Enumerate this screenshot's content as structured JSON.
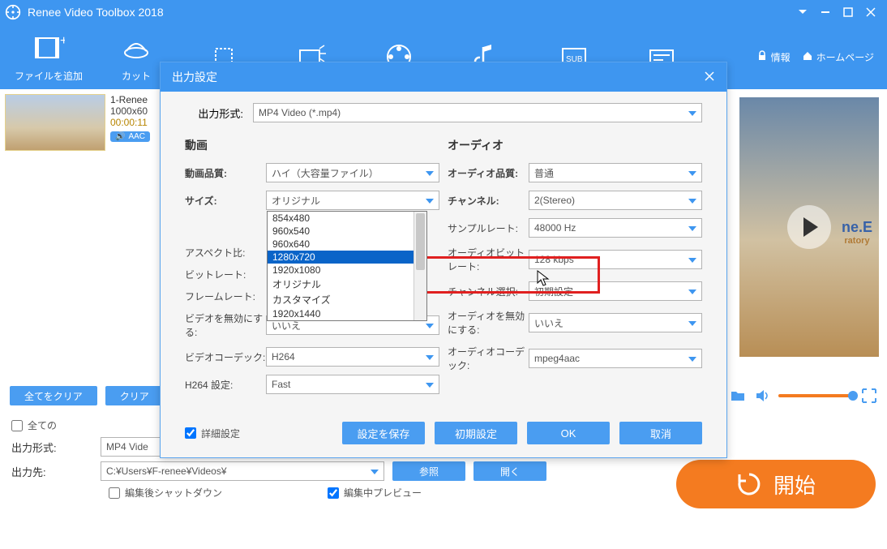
{
  "app": {
    "title": "Renee Video Toolbox 2018"
  },
  "window_buttons": {
    "drop": "▾",
    "min": "—",
    "max": "□",
    "close": "✕"
  },
  "toolbar": {
    "add_file": "ファイルを追加",
    "cut": "カット"
  },
  "header_links": {
    "info": "情報",
    "home": "ホームページ"
  },
  "file": {
    "name": "1-Renee",
    "size": "1000x60",
    "duration": "00:00:11",
    "codec": "AAC"
  },
  "preview": {
    "wm1": "ne.E",
    "wm2": "ratory"
  },
  "controls": {
    "clear_all": "全てをクリア",
    "clear": "クリア"
  },
  "bottom": {
    "all_chk": "全ての",
    "out_format_lbl": "出力形式:",
    "out_format_val": "MP4 Vide",
    "out_dest_lbl": "出力先:",
    "out_dest_val": "C:¥Users¥F-renee¥Videos¥",
    "browse": "参照",
    "open": "開く",
    "shutdown_chk": "編集後シャットダウン",
    "preview_chk": "編集中プレビュー",
    "start": "開始"
  },
  "modal": {
    "title": "出力設定",
    "top_lbl": "出力形式:",
    "top_val": "MP4 Video (*.mp4)",
    "video": {
      "heading": "動画",
      "quality_lbl": "動画品質:",
      "quality_val": "ハイ（大容量ファイル）",
      "size_lbl": "サイズ:",
      "size_val": "オリジナル",
      "size_options": [
        "854x480",
        "960x540",
        "960x640",
        "1280x720",
        "1920x1080",
        "オリジナル",
        "カスタマイズ",
        "1920x1440"
      ],
      "size_selected_index": 3,
      "aspect_lbl": "アスペクト比:",
      "bitrate_lbl": "ビットレート:",
      "framerate_lbl": "フレームレート:",
      "disable_video_lbl": "ビデオを無効にする:",
      "disable_video_val": "いいえ",
      "codec_lbl": "ビデオコーデック:",
      "codec_val": "H264",
      "h264_lbl": "H264 設定:",
      "h264_val": "Fast"
    },
    "audio": {
      "heading": "オーディオ",
      "quality_lbl": "オーディオ品質:",
      "quality_val": "普通",
      "channel_lbl": "チャンネル:",
      "channel_val": "2(Stereo)",
      "samplerate_lbl": "サンプルレート:",
      "samplerate_val": "48000 Hz",
      "bitrate_lbl": "オーディオビットレート:",
      "bitrate_val": "128 kbps",
      "chselect_lbl": "チャンネル選択:",
      "chselect_val": "初期設定",
      "disable_audio_lbl": "オーディオを無効にする:",
      "disable_audio_val": "いいえ",
      "codec_lbl": "オーディオコーデック:",
      "codec_val": "mpeg4aac"
    },
    "advanced_chk": "詳細設定",
    "buttons": {
      "save": "設定を保存",
      "reset": "初期設定",
      "ok": "OK",
      "cancel": "取消"
    }
  }
}
